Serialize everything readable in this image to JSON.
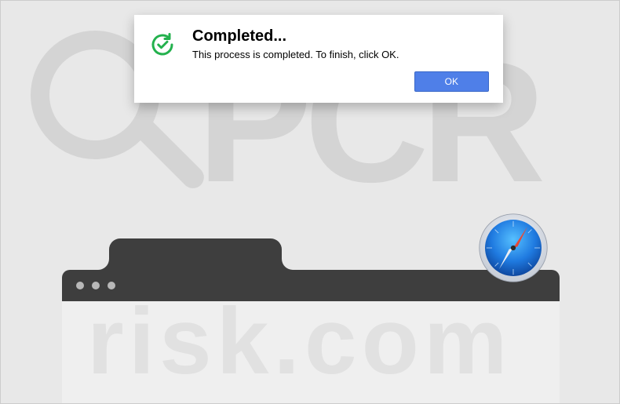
{
  "dialog": {
    "title": "Completed...",
    "message": "This process is completed. To finish, click OK.",
    "ok_label": "OK"
  },
  "watermark": {
    "top_text": "PCR",
    "bottom_text": "risk.com"
  },
  "icons": {
    "dialog_icon": "refresh-check-icon",
    "browser_icon": "safari-compass-icon"
  },
  "colors": {
    "dialog_accent": "#23b14d",
    "ok_button": "#4f7fe8",
    "chrome_dark": "#3e3e3e"
  }
}
